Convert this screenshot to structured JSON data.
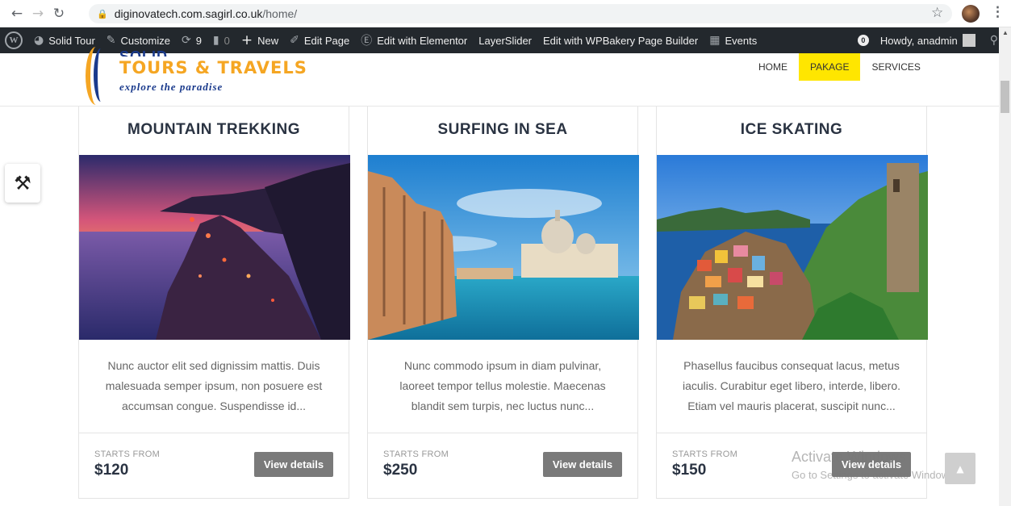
{
  "browser": {
    "url_host": "diginovatech.com.sagirl.co.uk",
    "url_path": "/home/"
  },
  "adminbar": {
    "site_name": "Solid Tour",
    "customize": "Customize",
    "updates_count": "9",
    "comments_count": "0",
    "new": "New",
    "edit_page": "Edit Page",
    "edit_elementor": "Edit with Elementor",
    "layerslider": "LayerSlider",
    "edit_wpbakery": "Edit with WPBakery Page Builder",
    "events": "Events",
    "notif_count": "0",
    "howdy": "Howdy, anadmin"
  },
  "header": {
    "brand_top": "SOLID",
    "brand": "TOURS & TRAVELS",
    "tagline": "explore the paradise",
    "nav": [
      "HOME",
      "PAKAGE",
      "SERVICES"
    ],
    "active_nav": "PAKAGE"
  },
  "cards": [
    {
      "title": "MOUNTAIN TREKKING",
      "description": "Nunc auctor elit sed dignissim mattis. Duis malesuada semper ipsum, non posuere est accumsan congue. Suspendisse id...",
      "starts_label": "STARTS FROM",
      "price": "$120",
      "button": "View details"
    },
    {
      "title": "SURFING IN SEA",
      "description": "Nunc commodo ipsum in diam pulvinar, laoreet tempor tellus molestie. Maecenas blandit sem turpis, nec luctus nunc...",
      "starts_label": "STARTS FROM",
      "price": "$250",
      "button": "View details"
    },
    {
      "title": "ICE SKATING",
      "description": "Phasellus faucibus consequat lacus, metus iaculis. Curabitur eget libero, interde, libero. Etiam vel mauris placerat, suscipit nunc...",
      "starts_label": "STARTS FROM",
      "price": "$150",
      "button": "View details"
    }
  ],
  "watermark": {
    "line1": "Activate Windows",
    "line2": "Go to Settings to activate Windows."
  },
  "colors": {
    "admin_bar": "#23282d",
    "active_nav": "#ffe600",
    "brand_orange": "#f5a623",
    "brand_blue": "#1a3a8c",
    "button_gray": "#7a7a7a"
  }
}
